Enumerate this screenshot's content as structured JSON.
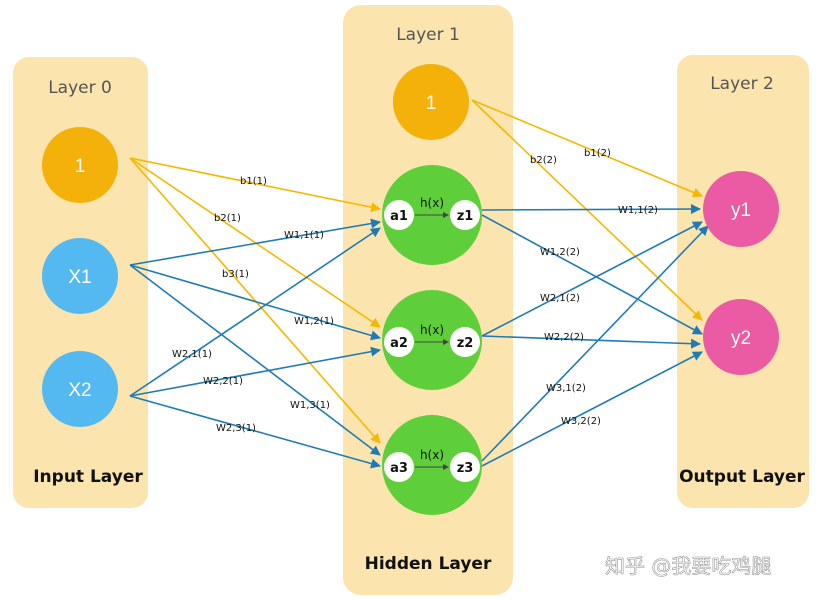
{
  "layers": [
    {
      "title": "Layer 0",
      "name": "Input Layer"
    },
    {
      "title": "Layer 1",
      "name": "Hidden Layer"
    },
    {
      "title": "Layer 2",
      "name": "Output Layer"
    }
  ],
  "nodes": {
    "input_bias": "1",
    "x1": "X1",
    "x2": "X2",
    "hidden_bias": "1",
    "y1": "y1",
    "y2": "y2"
  },
  "hidden_units": [
    {
      "a": "a1",
      "z": "z1",
      "fn": "h(x)"
    },
    {
      "a": "a2",
      "z": "z2",
      "fn": "h(x)"
    },
    {
      "a": "a3",
      "z": "z3",
      "fn": "h(x)"
    }
  ],
  "edge_labels": {
    "b1_1": "b1(1)",
    "b2_1": "b2(1)",
    "b3_1": "b3(1)",
    "w11_1": "W1,1(1)",
    "w12_1": "W1,2(1)",
    "w13_1": "W1,3(1)",
    "w21_1": "W2,1(1)",
    "w22_1": "W2,2(1)",
    "w23_1": "W2,3(1)",
    "b1_2": "b1(2)",
    "b2_2": "b2(2)",
    "w11_2": "W1,1(2)",
    "w12_2": "W1,2(2)",
    "w21_2": "W2,1(2)",
    "w22_2": "W2,2(2)",
    "w31_2": "W3,1(2)",
    "w32_2": "W3,2(2)"
  },
  "colors": {
    "panel": "#fbe4ad",
    "bias_node": "#f3b10a",
    "input_node": "#55b9f1",
    "hidden_node": "#5ecf3a",
    "output_node": "#ea5ba4",
    "bias_edge": "#f5b800",
    "weight_edge": "#1f7bb5"
  },
  "watermark": "知乎 @我要吃鸡腿"
}
